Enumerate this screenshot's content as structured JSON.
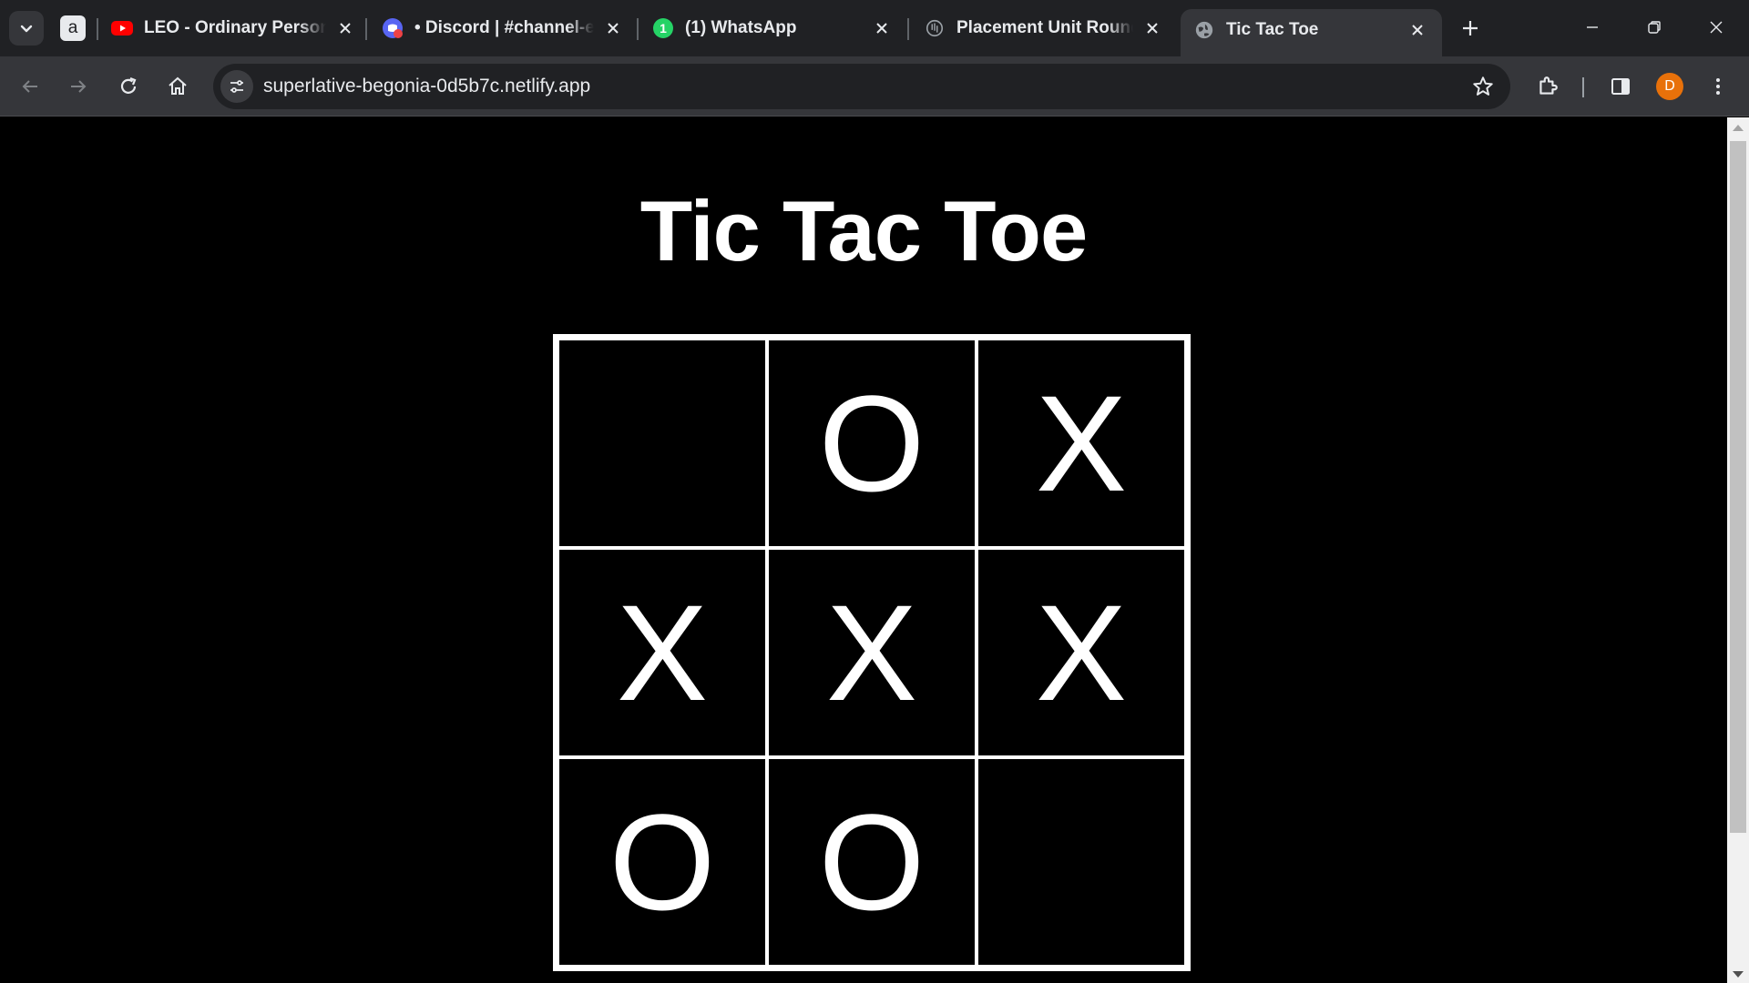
{
  "browser": {
    "tabs": [
      {
        "label": "a",
        "icon": "amazon-icon"
      },
      {
        "label": "LEO - Ordinary Person | ",
        "icon": "youtube-icon"
      },
      {
        "label": "• Discord | #channel-e-",
        "icon": "discord-icon"
      },
      {
        "label": "(1) WhatsApp",
        "icon": "whatsapp-icon",
        "badge": "1"
      },
      {
        "label": "Placement Unit Roundu",
        "icon": "openai-icon"
      },
      {
        "label": "Tic Tac Toe",
        "icon": "globe-icon",
        "active": true
      }
    ],
    "address": "superlative-begonia-0d5b7c.netlify.app",
    "profile_initial": "D",
    "colors": {
      "tabstrip": "#202124",
      "toolbar": "#35363a",
      "profile": "#e8710a"
    }
  },
  "page": {
    "title": "Tic Tac Toe",
    "board": [
      "",
      "O",
      "X",
      "X",
      "X",
      "X",
      "O",
      "O",
      ""
    ]
  }
}
